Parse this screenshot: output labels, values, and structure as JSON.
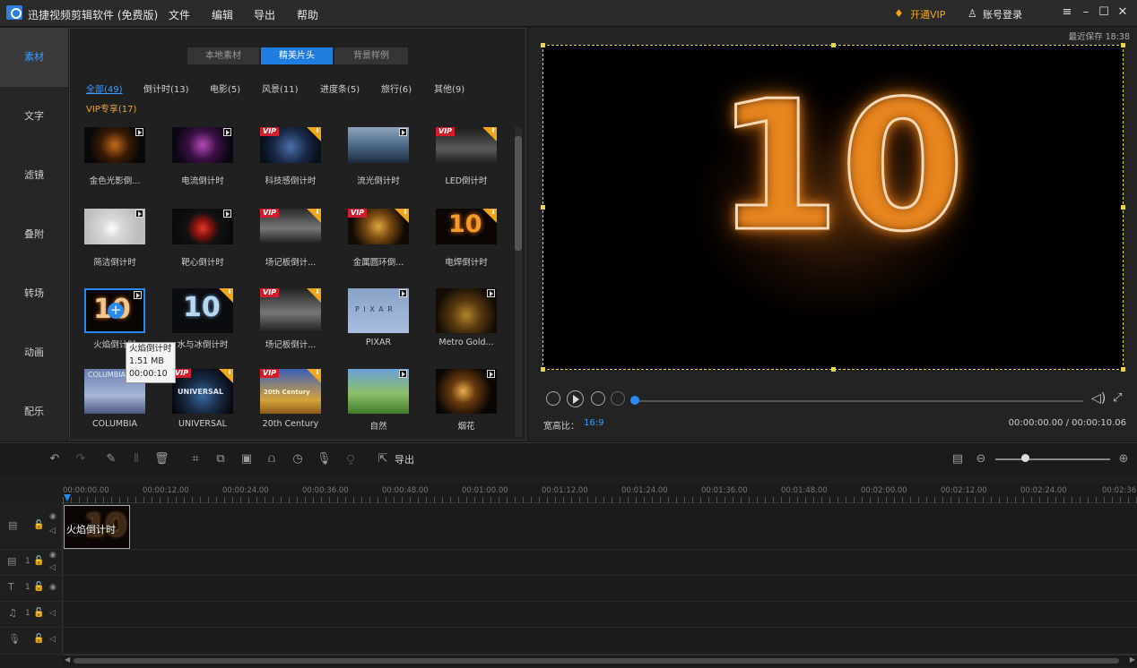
{
  "titlebar": {
    "app_title": "迅捷视频剪辑软件 (免费版)",
    "menu": [
      "文件",
      "编辑",
      "导出",
      "帮助"
    ],
    "vip": "开通VIP",
    "login": "账号登录"
  },
  "sidebar": {
    "items": [
      "素材",
      "文字",
      "滤镜",
      "叠附",
      "转场",
      "动画",
      "配乐"
    ]
  },
  "library": {
    "tabs": [
      "本地素材",
      "精美片头",
      "背景样例"
    ],
    "categories": [
      "全部(49)",
      "倒计时(13)",
      "电影(5)",
      "风景(11)",
      "进度条(5)",
      "旅行(6)",
      "其他(9)"
    ],
    "vip_category": "VIP专享(17)",
    "items": [
      "金色光影倒...",
      "电流倒计时",
      "科技感倒计时",
      "流光倒计时",
      "LED倒计时",
      "简洁倒计时",
      "靶心倒计时",
      "场记板倒计...",
      "金属圆环倒...",
      "电焊倒计时",
      "火焰倒计时",
      "水与冰倒计时",
      "场记板倒计...",
      "PIXAR",
      "Metro Gold...",
      "COLUMBIA",
      "UNIVERSAL",
      "20th Century",
      "自然",
      "烟花"
    ],
    "tooltip": {
      "name": "火焰倒计时",
      "size": "1.51 MB",
      "duration": "00:00:10"
    },
    "thumb_text": {
      "pixar": "P I X A R",
      "vip": "VIP",
      "ten": "10",
      "universal": "UNIVERSAL",
      "columbia": "COLUMBIA",
      "fox": "20th Century"
    }
  },
  "preview": {
    "recent_save": "最近保存 18:38",
    "ratio_label": "宽高比：",
    "ratio_value": "16:9",
    "timecode": "00:00:00.00 / 00:00:10.06",
    "big_number": "10",
    "progress": 0.0
  },
  "toolbar": {
    "export_label": "导出"
  },
  "timeline": {
    "ruler": [
      "00:00:00.00",
      "00:00:12.00",
      "00:00:24.00",
      "00:00:36.00",
      "00:00:48.00",
      "00:01:00.00",
      "00:01:12.00",
      "00:01:24.00",
      "00:01:36.00",
      "00:01:48.00",
      "00:02:00.00",
      "00:02:12.00",
      "00:02:24.00",
      "00:02:36"
    ],
    "clip_label": "火焰倒计时",
    "track_index": "1"
  }
}
